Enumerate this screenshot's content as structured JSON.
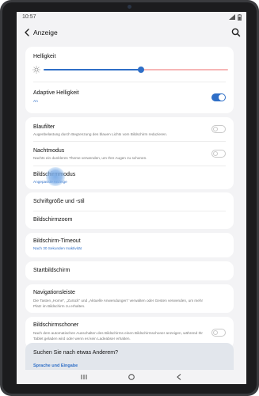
{
  "status": {
    "time": "10:57"
  },
  "header": {
    "title": "Anzeige"
  },
  "brightness": {
    "label": "Helligkeit",
    "level_percent": 53
  },
  "adaptive": {
    "title": "Adaptive Helligkeit",
    "sub": "An",
    "enabled": true
  },
  "bluelight": {
    "title": "Blaufilter",
    "sub": "Augenbelastung durch Begrenzung des blauen Lichts vom Bildschirm reduzieren.",
    "enabled": false
  },
  "nightmode": {
    "title": "Nachtmodus",
    "sub": "Nachts ein dunkleres Theme verwenden, um Ihre Augen zu schonen.",
    "enabled": false
  },
  "screenmode": {
    "title": "Bildschirmmodus",
    "sub": "Angepasste Anzeige"
  },
  "fontsize": {
    "title": "Schriftgröße und -stil"
  },
  "zoom": {
    "title": "Bildschirmzoom"
  },
  "timeout": {
    "title": "Bildschirm-Timeout",
    "sub": "Nach 30 Sekunden Inaktivität"
  },
  "home": {
    "title": "Startbildschirm"
  },
  "navbar_setting": {
    "title": "Navigationsleiste",
    "sub": "Die Tasten „Home“, „Zurück“ und „Aktuelle Anwendungen“ verwalten oder Gesten verwenden, um mehr Platz im Bildschirm zu erhalten."
  },
  "screensaver": {
    "title": "Bildschirmschoner",
    "sub": "Nach dem automatischen Ausschalten des Bildschirms einen Bildschirmschoner anzeigen, während Ihr Tablet geladen wird oder wenn es kein Ladeabser erhalten.",
    "enabled": false
  },
  "suggestions": {
    "title": "Suchen Sie nach etwas Anderem?",
    "link": "Sprache und Eingabe"
  },
  "colors": {
    "accent": "#2f6fc7",
    "screen_bg": "#f3f3f5",
    "card_bg": "#ffffff"
  }
}
